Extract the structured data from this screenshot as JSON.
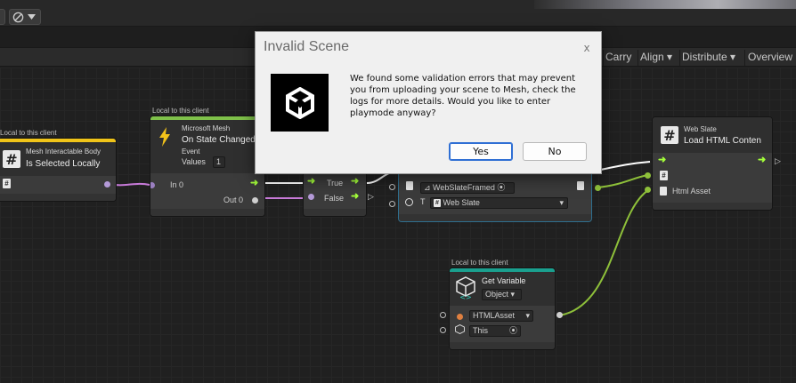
{
  "graph_toolbar": {
    "carry": "Carry",
    "align": "Align",
    "distribute": "Distribute",
    "overview": "Overview"
  },
  "nodes": {
    "mesh_body": {
      "caption": "Local to this client",
      "title": "Mesh Interactable Body",
      "subtitle": "Is Selected Locally"
    },
    "on_state": {
      "caption": "Local to this client",
      "title": "Microsoft Mesh",
      "subtitle": "On State Changed",
      "event_label": "Event",
      "values_label": "Values",
      "values_count": "1",
      "in_label": "In 0",
      "out_label": "Out 0"
    },
    "branch": {
      "true_label": "True",
      "false_label": "False"
    },
    "webslate_setter": {
      "target_value": "WebSlateFramed",
      "type_label": "T",
      "type_value": "Web Slate"
    },
    "load_html": {
      "title": "Web Slate",
      "subtitle": "Load HTML Conten",
      "input_label": "Html Asset"
    },
    "get_variable": {
      "caption": "Local to this client",
      "title": "Get Variable",
      "kind": "Object",
      "name_value": "HTMLAsset",
      "source_value": "This"
    }
  },
  "dialog": {
    "title": "Invalid Scene",
    "close": "x",
    "message": "We found some validation errors that may prevent you from uploading your scene to Mesh, check the logs for more details. Would you like to enter playmode anyway?",
    "yes": "Yes",
    "no": "No"
  },
  "colors": {
    "flow_port": "#a4ff3a",
    "value_wire": "#c77ad8",
    "object_wire": "#8ec03a",
    "state_stripe": "#7fc14a",
    "event_stripe": "#f0c419",
    "variable_stripe": "#1aa08f",
    "accent_button": "#2f6fd4"
  }
}
